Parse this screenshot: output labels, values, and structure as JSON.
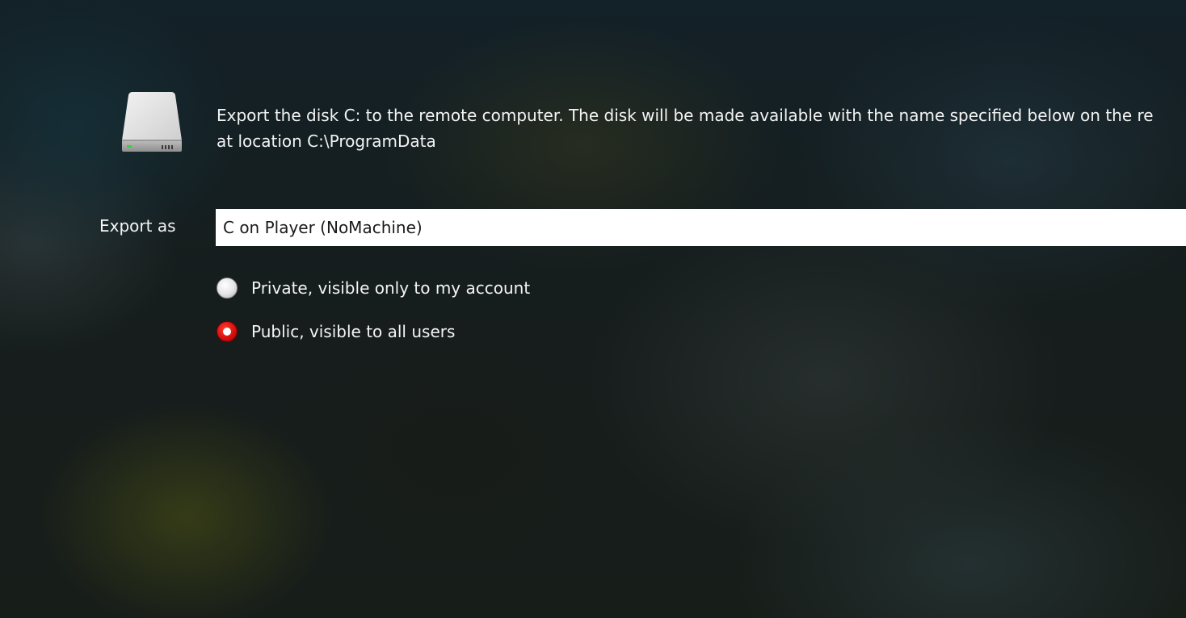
{
  "header": {
    "title_fragment": "· ·  ·"
  },
  "disk": {
    "icon": "hard-drive-icon",
    "description_line1": "Export the disk C: to the remote computer. The disk will be made available with the name specified below on the re",
    "description_line2": "at location C:\\ProgramData"
  },
  "export": {
    "label": "Export as",
    "value": "C on Player (NoMachine)"
  },
  "visibility": {
    "options": [
      {
        "label": "Private, visible only to my account",
        "selected": false
      },
      {
        "label": "Public, visible to all users",
        "selected": true
      }
    ],
    "selected_color": "#d40d0d"
  }
}
